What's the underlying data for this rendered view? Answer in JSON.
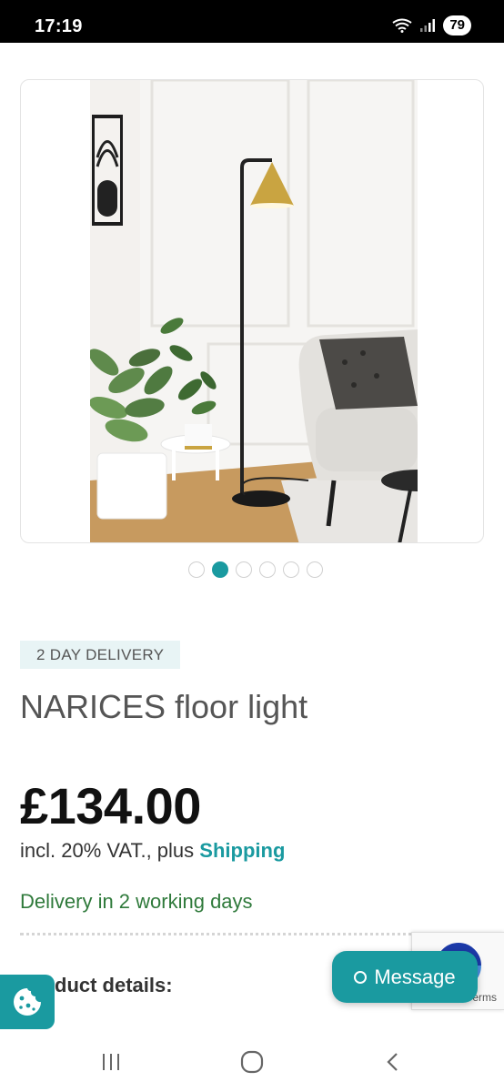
{
  "status_bar": {
    "time": "17:19",
    "battery": "79",
    "icons": [
      "wifi-icon",
      "signal-icon"
    ]
  },
  "carousel": {
    "total": 6,
    "active_index": 1
  },
  "product": {
    "badge": "2 DAY DELIVERY",
    "title": "NARICES floor light",
    "price": "£134.00",
    "vat_prefix": "incl. 20% VAT., plus",
    "shipping_link": "Shipping",
    "delivery_time": "Delivery in 2 working days",
    "details_heading": "duct details:"
  },
  "message_button": {
    "label": "Message"
  },
  "recaptcha": {
    "terms": "erms"
  },
  "colors": {
    "accent": "#1a9aa0",
    "delivery_green": "#2f7a3b",
    "badge_bg": "#e8f4f5"
  }
}
